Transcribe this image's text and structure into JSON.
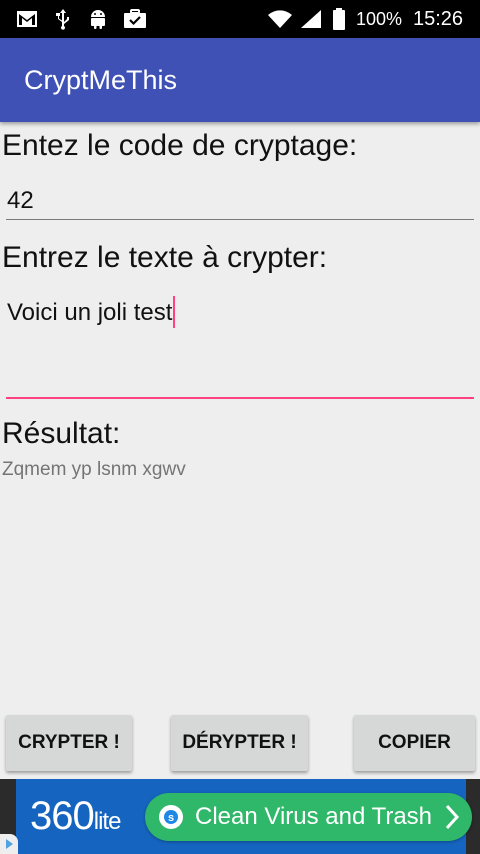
{
  "status_bar": {
    "battery_text": "100%",
    "time": "15:26",
    "icons": [
      "gmail-icon",
      "usb-icon",
      "android-icon",
      "briefcase-check-icon",
      "wifi-icon",
      "cellular-signal-icon",
      "battery-icon"
    ]
  },
  "app_bar": {
    "title": "CryptMeThis"
  },
  "form": {
    "code_label": "Entez le code de cryptage:",
    "code_value": "42",
    "text_label": "Entrez le texte à crypter:",
    "text_value": "Voici un joli test",
    "result_label": "Résultat:",
    "result_value": "Zqmem yp lsnm xgwv"
  },
  "buttons": {
    "crypt": "CRYPTER !",
    "decrypt": "DÉRYPTER !",
    "copy": "COPIER"
  },
  "ad": {
    "logo_main": "360",
    "logo_sub": "lite",
    "cta": "Clean Virus and Trash"
  },
  "colors": {
    "app_bar": "#3f51b5",
    "accent": "#ff4081",
    "background": "#eeeeee",
    "ad_green": "#2fb86a",
    "ad_blue": "#1565c0"
  }
}
